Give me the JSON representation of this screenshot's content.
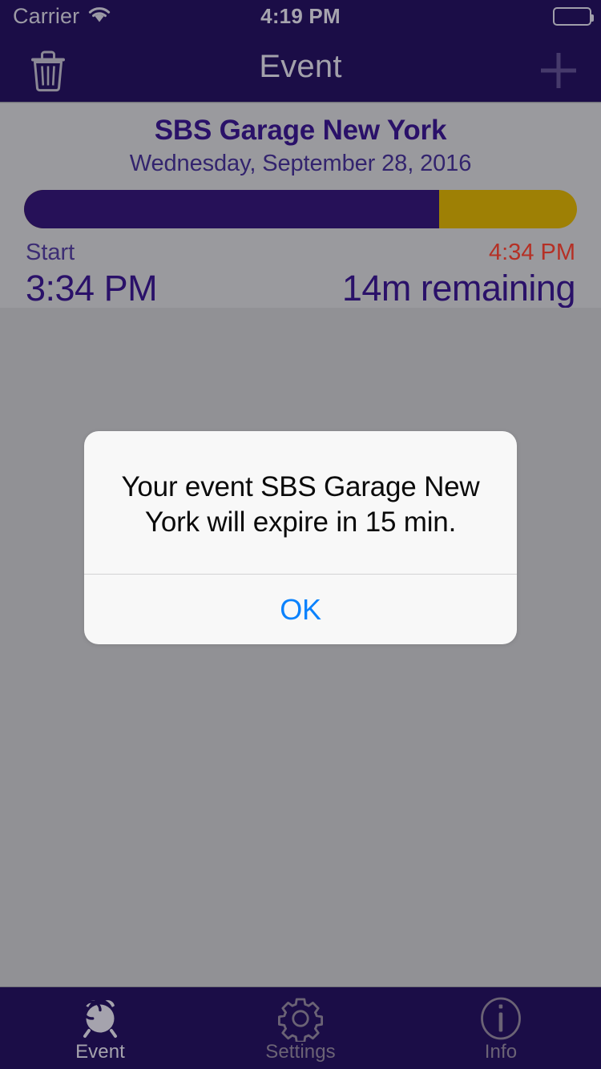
{
  "status_bar": {
    "carrier": "Carrier",
    "wifi_icon": "wifi-icon",
    "time": "4:19 PM",
    "battery_icon": "battery-full-icon"
  },
  "nav_bar": {
    "title": "Event",
    "delete_icon": "trash-icon",
    "add_icon": "plus-icon"
  },
  "event": {
    "title": "SBS Garage New York",
    "date": "Wednesday, September 28, 2016",
    "progress_percent": 75,
    "start_label": "Start",
    "start_value": "3:34 PM",
    "end_label": "4:34 PM",
    "end_value": "14m remaining",
    "colors": {
      "elapsed": "#261158",
      "remaining": "#9e8005",
      "title": "#2a1169",
      "end_label": "#b53025"
    }
  },
  "alert": {
    "message": "Your event SBS Garage New York will expire in 15 min.",
    "ok_label": "OK",
    "ok_color": "#0b82fd"
  },
  "tab_bar": {
    "items": [
      {
        "label": "Event",
        "icon": "alarm-clock-icon",
        "active": true
      },
      {
        "label": "Settings",
        "icon": "gear-icon",
        "active": false
      },
      {
        "label": "Info",
        "icon": "info-circle-icon",
        "active": false
      }
    ]
  }
}
